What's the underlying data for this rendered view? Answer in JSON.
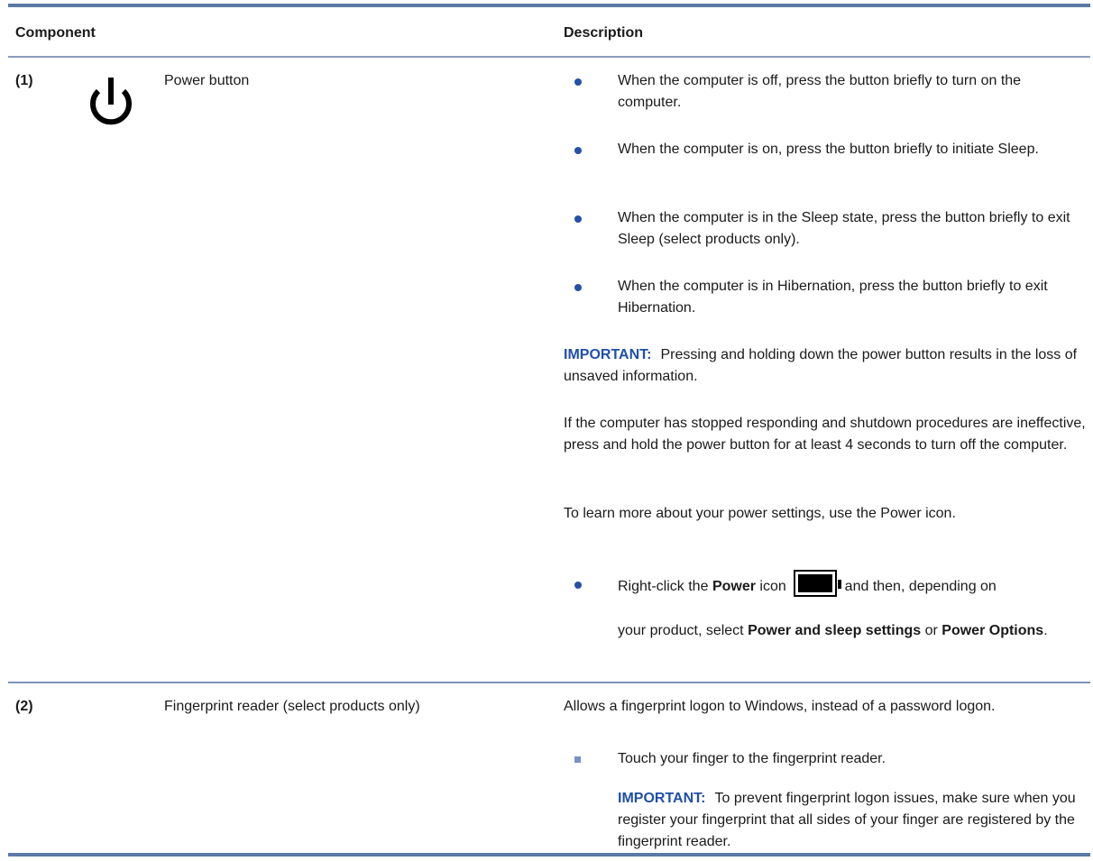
{
  "header": {
    "component": "Component",
    "description": "Description"
  },
  "rows": [
    {
      "number": "(1)",
      "icon": "power-icon",
      "name": "Power button",
      "bullets": [
        "When the computer is off, press the button briefly to turn on the computer.",
        "When the computer is on, press the button briefly to initiate Sleep.",
        "When the computer is in the Sleep state, press the button briefly to exit Sleep (select products only).",
        "When the computer is in Hibernation, press the button briefly to exit Hibernation."
      ],
      "important_label": "IMPORTANT:",
      "important_text": "Pressing and holding down the power button results in the loss of unsaved information.",
      "para1": "If the computer has stopped responding and shutdown procedures are ineffective, press and hold the power button for at least 4 seconds to turn off the computer.",
      "para2": "To learn more about your power settings, use the Power icon.",
      "last_bullet": {
        "pre": "Right-click the",
        "bold1": "Power",
        "mid": "icon",
        "icon": "battery-icon",
        "post": "and then, depending on",
        "line2_pre": "your product, select",
        "bold2": "Power and sleep settings",
        "or": "or",
        "bold3": "Power Options",
        "end": "."
      }
    },
    {
      "number": "(2)",
      "name": "Fingerprint reader (select products only)",
      "desc": "Allows a fingerprint logon to Windows, instead of a password logon.",
      "bullet": "Touch your finger to the fingerprint reader.",
      "important_label": "IMPORTANT:",
      "important_text": "To prevent fingerprint logon issues, make sure when you register your fingerprint that all sides of your finger are registered by the fingerprint reader."
    }
  ],
  "colors": {
    "accent": "#1f4fa8",
    "rule": "#5b7aa5"
  }
}
